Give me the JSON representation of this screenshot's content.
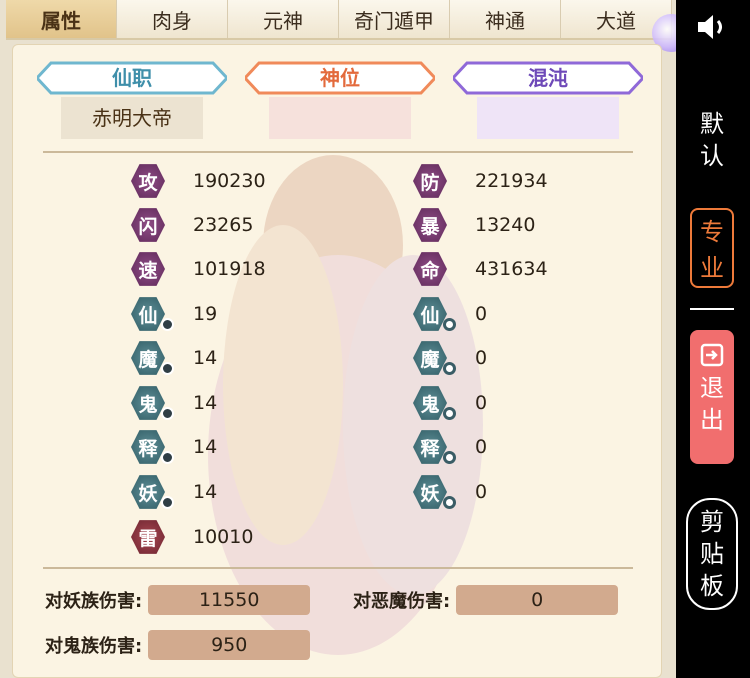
{
  "tabs": [
    "属性",
    "肉身",
    "元神",
    "奇门遁甲",
    "神通",
    "大道"
  ],
  "ranks": [
    {
      "label": "仙职",
      "value": "赤明大帝"
    },
    {
      "label": "神位",
      "value": ""
    },
    {
      "label": "混沌",
      "value": ""
    }
  ],
  "stats_left": [
    {
      "icon": "攻",
      "value": "190230"
    },
    {
      "icon": "闪",
      "value": "23265"
    },
    {
      "icon": "速",
      "value": "101918"
    },
    {
      "icon": "仙",
      "value": "19"
    },
    {
      "icon": "魔",
      "value": "14"
    },
    {
      "icon": "鬼",
      "value": "14"
    },
    {
      "icon": "释",
      "value": "14"
    },
    {
      "icon": "妖",
      "value": "14"
    },
    {
      "icon": "雷",
      "value": "10010"
    }
  ],
  "stats_right": [
    {
      "icon": "防",
      "value": "221934"
    },
    {
      "icon": "暴",
      "value": "13240"
    },
    {
      "icon": "命",
      "value": "431634"
    },
    {
      "icon": "仙",
      "value": "0"
    },
    {
      "icon": "魔",
      "value": "0"
    },
    {
      "icon": "鬼",
      "value": "0"
    },
    {
      "icon": "释",
      "value": "0"
    },
    {
      "icon": "妖",
      "value": "0"
    }
  ],
  "damage": [
    {
      "label": "对妖族伤害:",
      "value": "11550"
    },
    {
      "label": "对恶魔伤害:",
      "value": "0"
    },
    {
      "label": "对鬼族伤害:",
      "value": "950"
    }
  ],
  "sidebar": {
    "default": "默认",
    "pro": "专业",
    "exit": "退出",
    "clipboard": "剪贴板"
  },
  "colors": {
    "pro_accent": "#ee7a3a",
    "exit_bg": "#f16e6e",
    "damage_box": "#d2aa8e"
  }
}
